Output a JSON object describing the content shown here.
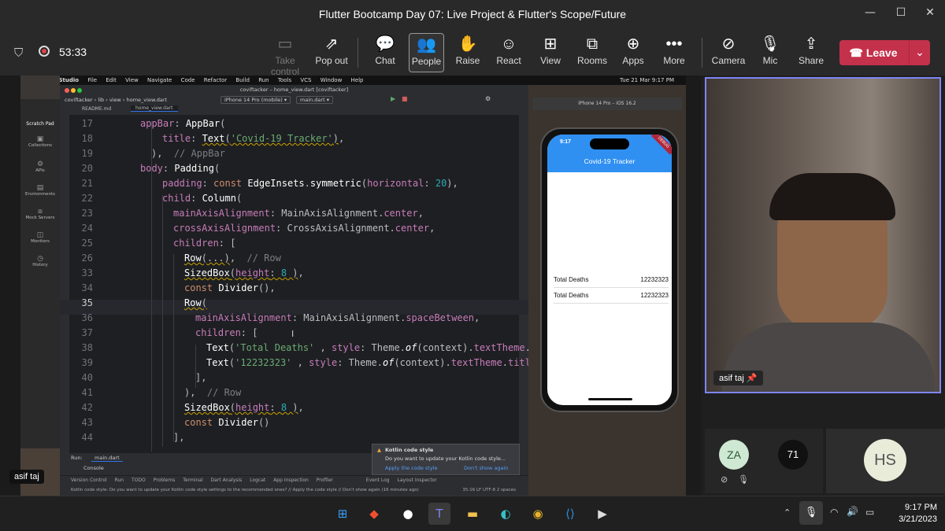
{
  "window": {
    "title": "Flutter Bootcamp Day 07: Live Project & Flutter's Scope/Future"
  },
  "meeting": {
    "timer": "53:33",
    "controls": [
      {
        "label": "Take control",
        "icon": "take-control-icon"
      },
      {
        "label": "Pop out",
        "icon": "pop-out-icon"
      },
      {
        "label": "Chat",
        "icon": "chat-icon"
      },
      {
        "label": "People",
        "icon": "people-icon"
      },
      {
        "label": "Raise",
        "icon": "raise-hand-icon"
      },
      {
        "label": "React",
        "icon": "react-icon"
      },
      {
        "label": "View",
        "icon": "view-icon"
      },
      {
        "label": "Rooms",
        "icon": "rooms-icon"
      },
      {
        "label": "Apps",
        "icon": "apps-icon"
      },
      {
        "label": "More",
        "icon": "more-icon"
      },
      {
        "label": "Camera",
        "icon": "camera-off-icon"
      },
      {
        "label": "Mic",
        "icon": "mic-off-icon"
      },
      {
        "label": "Share",
        "icon": "share-icon"
      }
    ],
    "leave_label": "Leave",
    "accent": "#c4314b"
  },
  "mac": {
    "menu": [
      "Android Studio",
      "File",
      "Edit",
      "View",
      "Navigate",
      "Code",
      "Refactor",
      "Build",
      "Run",
      "Tools",
      "VCS",
      "Window",
      "Help"
    ],
    "datetime": "Tue 21 Mar  9:17 PM"
  },
  "left_panel": {
    "title": "Scratch Pad",
    "items": [
      "Collections",
      "APIs",
      "Environments",
      "Mock Servers",
      "Monitors",
      "History"
    ]
  },
  "ide": {
    "window_title": "coviftacker – home_view.dart [coviftacker]",
    "breadcrumb": [
      "coviftacker",
      "lib",
      "view",
      "home_view.dart"
    ],
    "device": "iPhone 14 Pro (mobile)",
    "run_config": "main.dart",
    "tabs": [
      "README.md",
      "home_view.dart"
    ],
    "lines": [
      {
        "n": "17",
        "text": "appBar: AppBar("
      },
      {
        "n": "18",
        "text": "title: Text('Covid-19 Tracker'),"
      },
      {
        "n": "19",
        "text": "),  // AppBar"
      },
      {
        "n": "20",
        "text": "body: Padding("
      },
      {
        "n": "21",
        "text": "padding: const EdgeInsets.symmetric(horizontal: 20),"
      },
      {
        "n": "22",
        "text": "child: Column("
      },
      {
        "n": "23",
        "text": "mainAxisAlignment: MainAxisAlignment.center,"
      },
      {
        "n": "24",
        "text": "crossAxisAlignment: CrossAxisAlignment.center,"
      },
      {
        "n": "25",
        "text": "children: ["
      },
      {
        "n": "26",
        "text": "Row(...),  // Row"
      },
      {
        "n": "33",
        "text": "SizedBox(height: 8 ),"
      },
      {
        "n": "34",
        "text": "const Divider(),"
      },
      {
        "n": "35",
        "text": "Row("
      },
      {
        "n": "36",
        "text": "mainAxisAlignment: MainAxisAlignment.spaceBetween,"
      },
      {
        "n": "37",
        "text": "children: ["
      },
      {
        "n": "38",
        "text": "Text('Total Deaths' , style: Theme.of(context).textTheme."
      },
      {
        "n": "39",
        "text": "Text('12232323' , style: Theme.of(context).textTheme.titl"
      },
      {
        "n": "40",
        "text": "],"
      },
      {
        "n": "41",
        "text": "),  // Row"
      },
      {
        "n": "42",
        "text": "SizedBox(height: 8 ),"
      },
      {
        "n": "43",
        "text": "const Divider()"
      },
      {
        "n": "44",
        "text": "],"
      }
    ],
    "run_tab": "main.dart",
    "console_label": "Console",
    "notification": {
      "title": "Kotlin code style",
      "body": "Do you want to update your Kotlin code style...",
      "action1": "Apply the code style",
      "action2": "Don't show again"
    },
    "bottom_tabs": [
      "Version Control",
      "Run",
      "TODO",
      "Problems",
      "Terminal",
      "Dart Analysis",
      "Logcat",
      "App Inspection",
      "Profiler",
      "Event Log",
      "Layout Inspector"
    ],
    "status": "Kotlin code style: Do you want to update your Kotlin code style settings to the recommended ones? // Apply the code style // Don't show again (16 minutes ago)",
    "status_right": "35:16  LF  UTF-8  2 spaces"
  },
  "simulator": {
    "title": "iPhone 14 Pro – iOS 16.2",
    "clock": "9:17",
    "app_title": "Covid-19 Tracker",
    "rows": [
      {
        "label": "Total Deaths",
        "value": "12232323"
      },
      {
        "label": "Total Deaths",
        "value": "12232323"
      }
    ]
  },
  "participants": {
    "presenter": "asif taj",
    "video_name": "asif taj",
    "others": [
      {
        "initials": "ZA",
        "color": "#cfe8d3"
      },
      {
        "initials": "71",
        "color": "#111111"
      },
      {
        "initials": "HS",
        "color": "#e8ecd9"
      }
    ]
  },
  "taskbar": {
    "apps": [
      "windows-start-icon",
      "git-icon",
      "github-icon",
      "teams-icon",
      "file-explorer-icon",
      "edge-icon",
      "chrome-icon",
      "vscode-icon",
      "media-player-icon"
    ],
    "time": "9:17 PM",
    "date": "3/21/2023"
  }
}
